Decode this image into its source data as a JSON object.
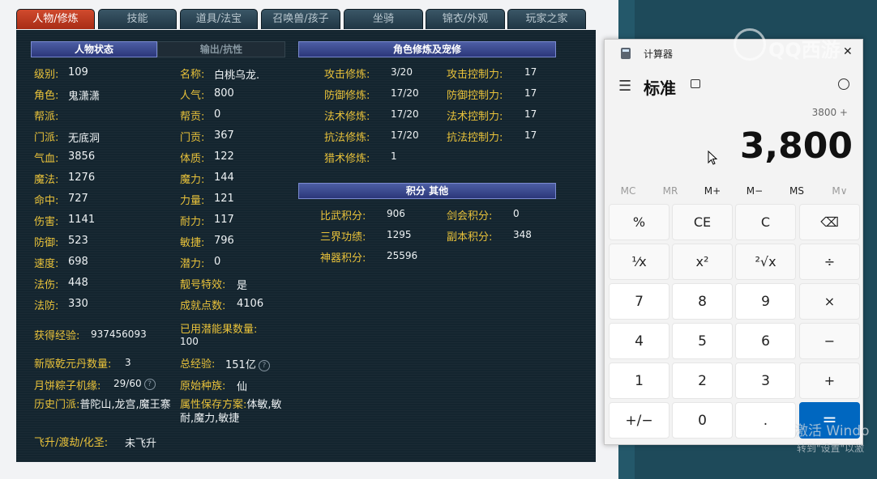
{
  "tabs": [
    {
      "label": "人物/修炼",
      "active": true
    },
    {
      "label": "技能"
    },
    {
      "label": "道具/法宝"
    },
    {
      "label": "召唤兽/孩子"
    },
    {
      "label": "坐骑"
    },
    {
      "label": "锦衣/外观"
    },
    {
      "label": "玩家之家"
    }
  ],
  "panel": {
    "header_status": "人物状态",
    "header_output": "输出/抗性",
    "header_cultivation": "角色修炼及宠修",
    "header_points": "积分 其他",
    "left_col": [
      {
        "label": "级别:",
        "value": "109"
      },
      {
        "label": "角色:",
        "value": "鬼潇潇"
      },
      {
        "label": "帮派:",
        "value": ""
      },
      {
        "label": "门派:",
        "value": "无底洞"
      },
      {
        "label": "气血:",
        "value": "3856"
      },
      {
        "label": "魔法:",
        "value": "1276"
      },
      {
        "label": "命中:",
        "value": "727"
      },
      {
        "label": "伤害:",
        "value": "1141"
      },
      {
        "label": "防御:",
        "value": "523"
      },
      {
        "label": "速度:",
        "value": "698"
      },
      {
        "label": "法伤:",
        "value": "448"
      },
      {
        "label": "法防:",
        "value": "330"
      }
    ],
    "mid_col": [
      {
        "label": "名称:",
        "value": "白桃乌龙."
      },
      {
        "label": "人气:",
        "value": "800"
      },
      {
        "label": "帮贡:",
        "value": "0"
      },
      {
        "label": "门贡:",
        "value": "367"
      },
      {
        "label": "体质:",
        "value": "122"
      },
      {
        "label": "魔力:",
        "value": "144"
      },
      {
        "label": "力量:",
        "value": "121"
      },
      {
        "label": "耐力:",
        "value": "117"
      },
      {
        "label": "敏捷:",
        "value": "796"
      },
      {
        "label": "潜力:",
        "value": "0"
      },
      {
        "label": "靓号特效:",
        "value": "是"
      },
      {
        "label": "成就点数:",
        "value": "4106"
      }
    ],
    "exp_label": "获得经验:",
    "exp_value": "937456093",
    "potion_label": "已用潜能果数量:",
    "potion_value": "100",
    "qianyuan_label": "新版乾元丹数量:",
    "qianyuan_value": "3",
    "total_exp_label": "总经验:",
    "total_exp_value": "151亿",
    "mooncake_label": "月饼粽子机缘:",
    "mooncake_value": "29/60",
    "race_label": "原始种族:",
    "race_value": "仙",
    "history_label": "历史门派:",
    "history_value": "普陀山,龙宫,魔王寨",
    "attr_label": "属性保存方案:",
    "attr_value": "体敏,敏耐,魔力,敏捷",
    "ascend_label": "飞升/渡劫/化圣:",
    "ascend_value": "未飞升",
    "help_glyph": "?",
    "cultivation": [
      {
        "label": "攻击修炼:",
        "value": "3/20",
        "label2": "攻击控制力:",
        "value2": "17"
      },
      {
        "label": "防御修炼:",
        "value": "17/20",
        "label2": "防御控制力:",
        "value2": "17"
      },
      {
        "label": "法术修炼:",
        "value": "17/20",
        "label2": "法术控制力:",
        "value2": "17"
      },
      {
        "label": "抗法修炼:",
        "value": "17/20",
        "label2": "抗法控制力:",
        "value2": "17"
      },
      {
        "label": "猎术修炼:",
        "value": "1"
      }
    ],
    "points": [
      {
        "label": "比武积分:",
        "value": "906",
        "label2": "剑会积分:",
        "value2": "0"
      },
      {
        "label": "三界功绩:",
        "value": "1295",
        "label2": "副本积分:",
        "value2": "348"
      },
      {
        "label": "神器积分:",
        "value": "25596"
      }
    ]
  },
  "calculator": {
    "title": "计算器",
    "mode": "标准",
    "expression": "3800 +",
    "display": "3,800",
    "memory": [
      "MC",
      "MR",
      "M+",
      "M−",
      "MS",
      "M∨"
    ],
    "buttons": [
      [
        "%",
        "CE",
        "C",
        "⌫"
      ],
      [
        "¹⁄x",
        "x²",
        "²√x",
        "÷"
      ],
      [
        "7",
        "8",
        "9",
        "×"
      ],
      [
        "4",
        "5",
        "6",
        "−"
      ],
      [
        "1",
        "2",
        "3",
        "+"
      ],
      [
        "+/−",
        "0",
        ".",
        "="
      ]
    ]
  },
  "watermark": {
    "logo_text": "QQ西游",
    "activate_line1": "激活 Windo",
    "activate_line2": "转到\"设置\"以激"
  },
  "colors": {
    "label": "#e9c23a",
    "accent": "#0067c0",
    "tab_active": "#c23c22"
  }
}
